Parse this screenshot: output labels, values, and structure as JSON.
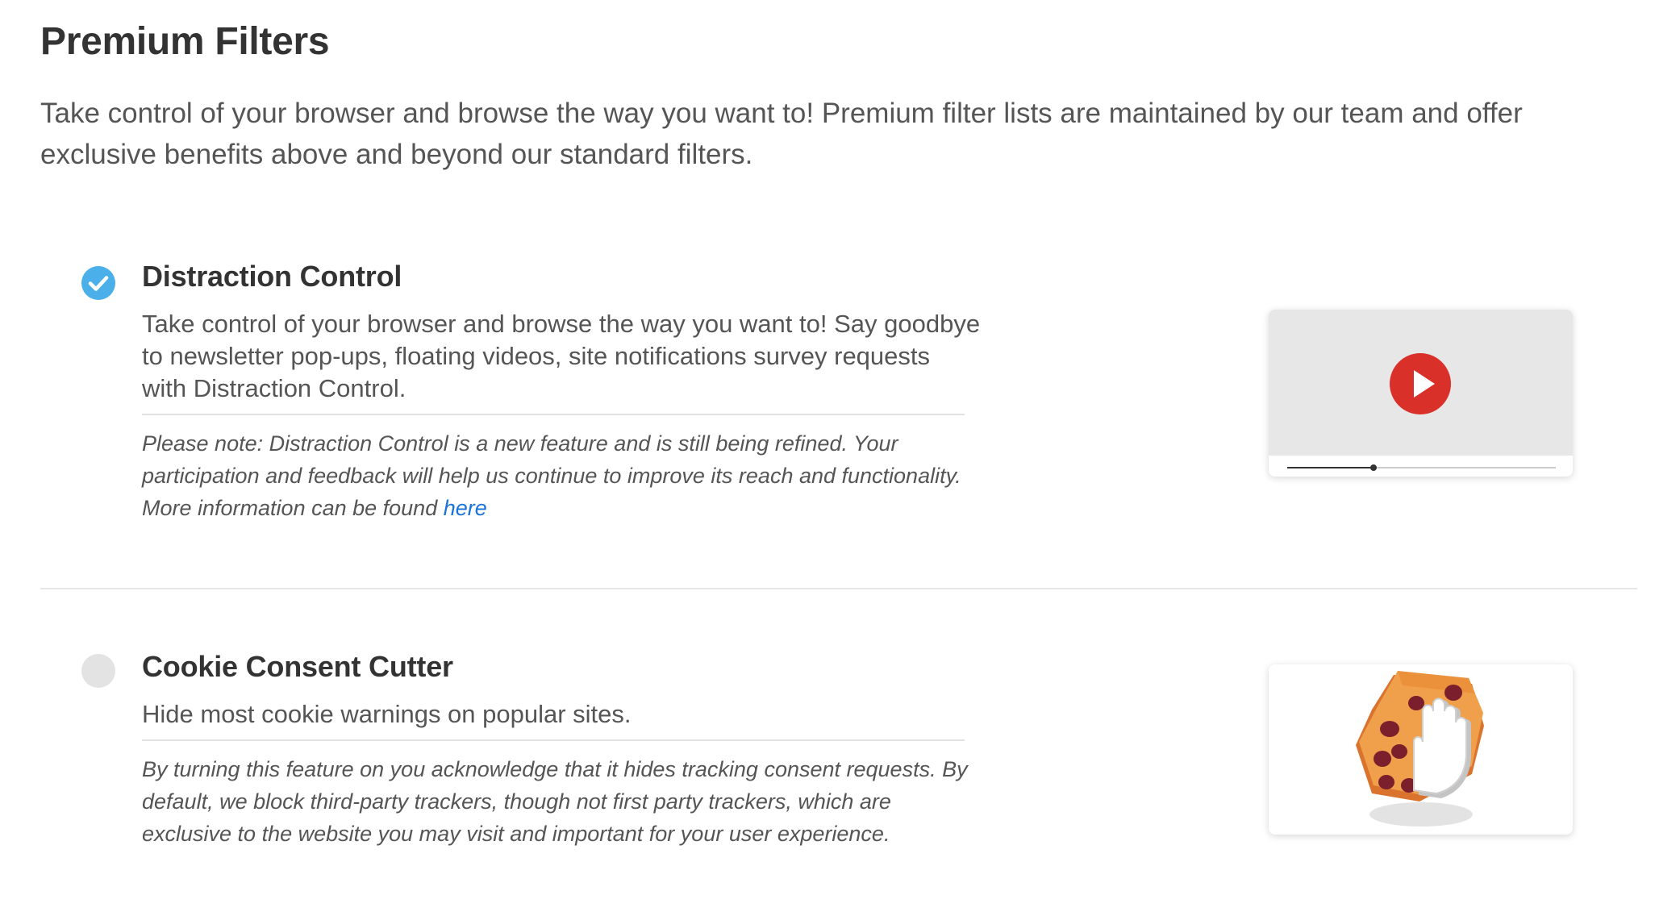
{
  "header": {
    "title": "Premium Filters",
    "description": "Take control of your browser and browse the way you want to! Premium filter lists are maintained by our team and offer exclusive benefits above and beyond our standard filters."
  },
  "features": [
    {
      "name": "Distraction Control",
      "enabled": true,
      "description": "Take control of your browser and browse the way you want to! Say goodbye to newsletter pop-ups, floating videos, site notifications survey requests with Distraction Control.",
      "note": "Please note: Distraction Control is a new feature and is still being refined. Your participation and feedback will help us continue to improve its reach and functionality. More information can be found",
      "link_text": "here",
      "illustration": "video-player-illustration",
      "video_progress": 0.32
    },
    {
      "name": "Cookie Consent Cutter",
      "enabled": false,
      "description": "Hide most cookie warnings on popular sites.",
      "note": "By turning this feature on you acknowledge that it hides tracking consent requests. By default, we block third-party trackers, though not first party trackers, which are exclusive to the website you may visit and important for your user experience.",
      "illustration": "cookie-stop-hand-illustration"
    }
  ],
  "colors": {
    "toggle_on": "#4bb0ea",
    "toggle_off": "#e3e3e3",
    "link": "#1a73d9",
    "play_button": "#d9302a",
    "cookie": "#f0a04a",
    "chocolate_chip": "#7a1f2b"
  },
  "icons": {
    "toggle_on": "checkmark-icon",
    "play": "play-icon",
    "hand": "stop-hand-icon"
  }
}
